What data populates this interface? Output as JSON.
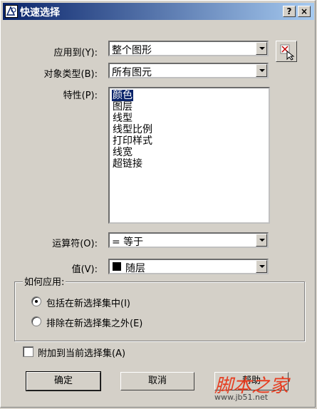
{
  "window": {
    "title": "快速选择",
    "help_label": "?",
    "close_label": "×"
  },
  "fields": {
    "apply_to": {
      "label": "应用到(Y):",
      "value": "整个图形"
    },
    "object_type": {
      "label": "对象类型(B):",
      "value": "所有图元"
    },
    "properties": {
      "label": "特性(P):",
      "items": [
        "颜色",
        "图层",
        "线型",
        "线型比例",
        "打印样式",
        "线宽",
        "超链接"
      ],
      "selected_index": 0
    },
    "operator": {
      "label": "运算符(O):",
      "value": "= 等于"
    },
    "value": {
      "label": "值(V):",
      "value": "随层",
      "swatch_color": "#000000"
    }
  },
  "how_to_apply": {
    "label": "如何应用:",
    "options": [
      {
        "label": "包括在新选择集中(I)",
        "checked": true
      },
      {
        "label": "排除在新选择集之外(E)",
        "checked": false
      }
    ]
  },
  "append_checkbox": {
    "label": "附加到当前选择集(A)",
    "checked": false
  },
  "buttons": {
    "ok": "确定",
    "cancel": "取消",
    "help": "帮助"
  },
  "watermark": {
    "text": "脚本之家",
    "url": "www.jb51.net"
  },
  "colors": {
    "title_start": "#0a246a",
    "title_end": "#a6caf0",
    "dialog_bg": "#d4d0c8",
    "selection": "#0a246a"
  }
}
